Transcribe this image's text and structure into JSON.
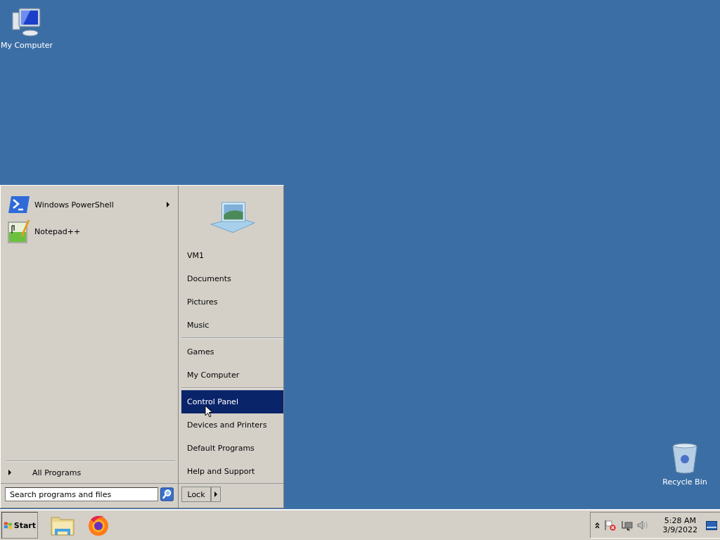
{
  "desktop_icons": [
    {
      "label": "My Computer",
      "kind": "computer"
    },
    {
      "label": "Recycle Bin",
      "kind": "recycle"
    }
  ],
  "start_menu": {
    "pinned": [
      {
        "label": "Windows PowerShell",
        "kind": "powershell",
        "has_submenu": true
      },
      {
        "label": "Notepad++",
        "kind": "notepad",
        "has_submenu": false
      }
    ],
    "all_programs": "All Programs",
    "search": {
      "placeholder": "Search programs and files"
    },
    "right_items": [
      {
        "label": "VM1",
        "divider_after": false,
        "selected": false
      },
      {
        "label": "Documents",
        "divider_after": false,
        "selected": false
      },
      {
        "label": "Pictures",
        "divider_after": false,
        "selected": false
      },
      {
        "label": "Music",
        "divider_after": true,
        "selected": false
      },
      {
        "label": "Games",
        "divider_after": false,
        "selected": false
      },
      {
        "label": "My Computer",
        "divider_after": true,
        "selected": false
      },
      {
        "label": "Control Panel",
        "divider_after": false,
        "selected": true
      },
      {
        "label": "Devices and Printers",
        "divider_after": false,
        "selected": false
      },
      {
        "label": "Default Programs",
        "divider_after": false,
        "selected": false
      },
      {
        "label": "Help and Support",
        "divider_after": false,
        "selected": false
      }
    ],
    "lock_button": "Lock"
  },
  "taskbar": {
    "start": "Start",
    "apps": [
      {
        "kind": "explorer"
      },
      {
        "kind": "firefox"
      }
    ],
    "tray": {
      "time": "5:28 AM",
      "date": "3/9/2022"
    }
  }
}
